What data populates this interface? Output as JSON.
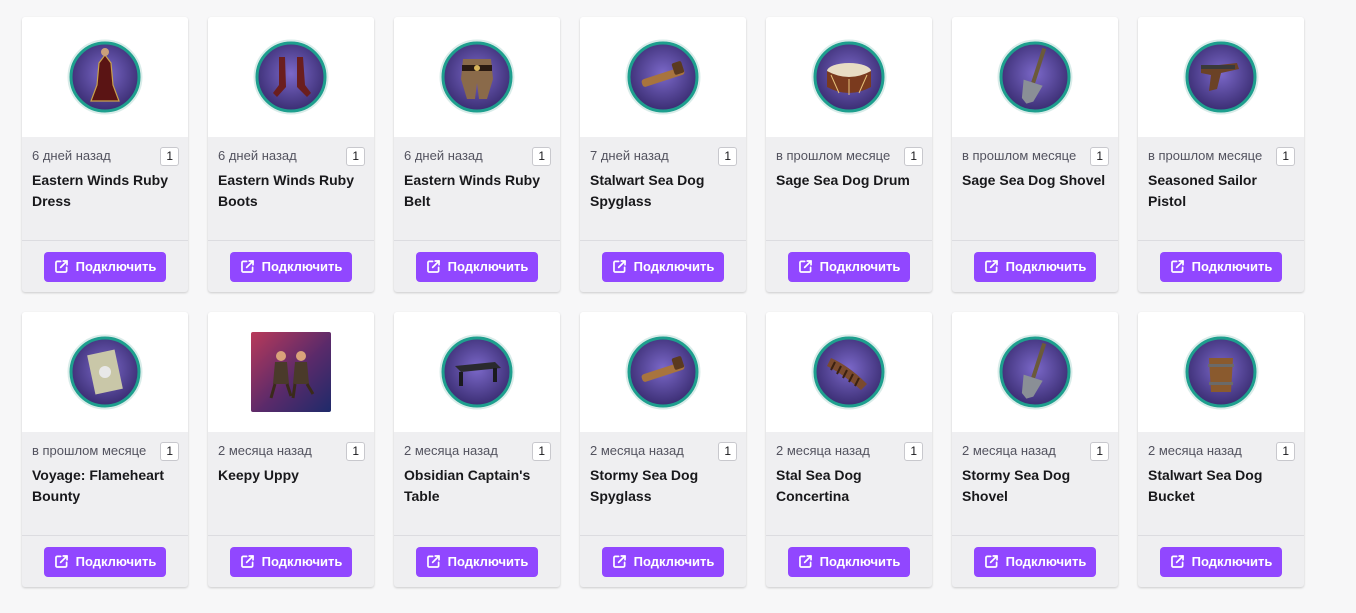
{
  "colors": {
    "accent": "#9147ff",
    "card_bg": "#efeff1",
    "page_bg": "#f7f7f8",
    "medallion_rim": "#1e9f8e",
    "medallion_fill": "#4a3a8c"
  },
  "drops": [
    {
      "age": "6 дней назад",
      "count": "1",
      "title": "Eastern Winds Ruby Dress",
      "icon": "ruby-dress-icon",
      "button_label": "Подключить"
    },
    {
      "age": "6 дней назад",
      "count": "1",
      "title": "Eastern Winds Ruby Boots",
      "icon": "ruby-boots-icon",
      "button_label": "Подключить"
    },
    {
      "age": "6 дней назад",
      "count": "1",
      "title": "Eastern Winds Ruby Belt",
      "icon": "ruby-belt-icon",
      "button_label": "Подключить"
    },
    {
      "age": "7 дней назад",
      "count": "1",
      "title": "Stalwart Sea Dog Spyglass",
      "icon": "spyglass-icon",
      "button_label": "Подключить"
    },
    {
      "age": "в прошлом месяце",
      "count": "1",
      "title": "Sage Sea Dog Drum",
      "icon": "drum-icon",
      "button_label": "Подключить"
    },
    {
      "age": "в прошлом месяце",
      "count": "1",
      "title": "Sage Sea Dog Shovel",
      "icon": "shovel-icon",
      "button_label": "Подключить"
    },
    {
      "age": "в прошлом месяце",
      "count": "1",
      "title": "Seasoned Sailor Pistol",
      "icon": "pistol-icon",
      "button_label": "Подключить"
    },
    {
      "age": "в прошлом месяце",
      "count": "1",
      "title": "Voyage: Flameheart Bounty",
      "icon": "bounty-scroll-icon",
      "button_label": "Подключить"
    },
    {
      "age": "2 месяца назад",
      "count": "1",
      "title": "Keepy Uppy",
      "icon": "emote-image-icon",
      "button_label": "Подключить"
    },
    {
      "age": "2 месяца назад",
      "count": "1",
      "title": "Obsidian Captain's Table",
      "icon": "table-icon",
      "button_label": "Подключить"
    },
    {
      "age": "2 месяца назад",
      "count": "1",
      "title": "Stormy Sea Dog Spyglass",
      "icon": "spyglass-icon",
      "button_label": "Подключить"
    },
    {
      "age": "2 месяца назад",
      "count": "1",
      "title": "Stal Sea Dog Concertina",
      "icon": "concertina-icon",
      "button_label": "Подключить"
    },
    {
      "age": "2 месяца назад",
      "count": "1",
      "title": "Stormy Sea Dog Shovel",
      "icon": "shovel-icon",
      "button_label": "Подключить"
    },
    {
      "age": "2 месяца назад",
      "count": "1",
      "title": "Stalwart Sea Dog Bucket",
      "icon": "bucket-icon",
      "button_label": "Подключить"
    }
  ]
}
